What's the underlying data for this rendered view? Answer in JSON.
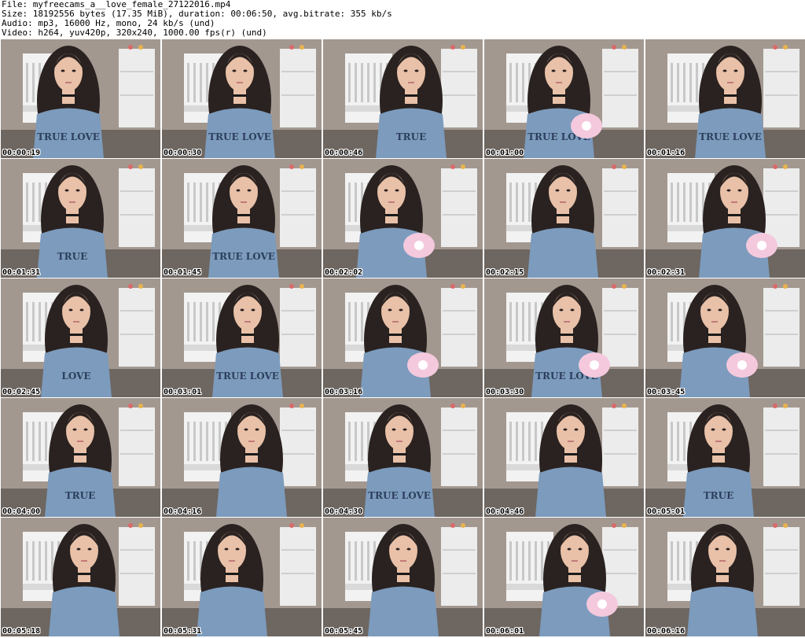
{
  "header": {
    "file": "File: myfreecams_a__love_female_27122016.mp4",
    "size": "Size: 18192556 bytes (17.35 MiB), duration: 00:06:50, avg.bitrate: 355 kb/s",
    "audio": "Audio: mp3, 16000 Hz, mono, 24 kb/s (und)",
    "video": "Video: h264, yuv420p, 320x240, 1000.00 fps(r) (und)"
  },
  "frames": [
    {
      "timestamp": "00:00:19",
      "shirt_text": "TRUE LOVE"
    },
    {
      "timestamp": "00:00:30",
      "shirt_text": "TRUE LOVE"
    },
    {
      "timestamp": "00:00:46",
      "shirt_text": "TRUE"
    },
    {
      "timestamp": "00:01:00",
      "shirt_text": "TRUE LOVE"
    },
    {
      "timestamp": "00:01:16",
      "shirt_text": "TRUE LOVE"
    },
    {
      "timestamp": "00:01:31",
      "shirt_text": "TRUE"
    },
    {
      "timestamp": "00:01:45",
      "shirt_text": "TRUE LOVE"
    },
    {
      "timestamp": "00:02:02",
      "shirt_text": ""
    },
    {
      "timestamp": "00:02:15",
      "shirt_text": ""
    },
    {
      "timestamp": "00:02:31",
      "shirt_text": ""
    },
    {
      "timestamp": "00:02:45",
      "shirt_text": "LOVE"
    },
    {
      "timestamp": "00:03:01",
      "shirt_text": "TRUE LOVE"
    },
    {
      "timestamp": "00:03:16",
      "shirt_text": ""
    },
    {
      "timestamp": "00:03:30",
      "shirt_text": "TRUE LOVE"
    },
    {
      "timestamp": "00:03:45",
      "shirt_text": ""
    },
    {
      "timestamp": "00:04:00",
      "shirt_text": "TRUE"
    },
    {
      "timestamp": "00:04:16",
      "shirt_text": ""
    },
    {
      "timestamp": "00:04:30",
      "shirt_text": "TRUE LOVE"
    },
    {
      "timestamp": "00:04:46",
      "shirt_text": ""
    },
    {
      "timestamp": "00:05:01",
      "shirt_text": "TRUE"
    },
    {
      "timestamp": "00:05:18",
      "shirt_text": ""
    },
    {
      "timestamp": "00:05:31",
      "shirt_text": ""
    },
    {
      "timestamp": "00:05:45",
      "shirt_text": ""
    },
    {
      "timestamp": "00:06:01",
      "shirt_text": ""
    },
    {
      "timestamp": "00:06:16",
      "shirt_text": ""
    }
  ],
  "colors": {
    "wall": "#a39890",
    "crib": "#f2f2f2",
    "floor": "#6e6660",
    "hair": "#2a2220",
    "skin": "#e8c1a8",
    "shirt": "#7c9bbd",
    "pink_device": "#f4c9dd"
  }
}
